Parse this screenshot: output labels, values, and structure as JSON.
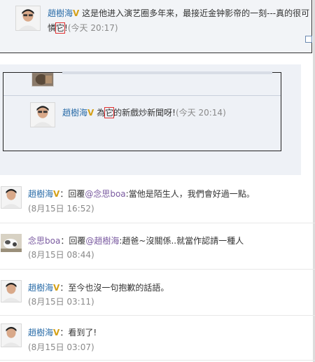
{
  "top_comment": {
    "author": "趙樹海",
    "verified_icon": "V",
    "text_part1": "这是他进入演艺圈多年来，最接近金钟影帝的一刻---真的很可",
    "text_part2": "憐",
    "highlight": "它",
    "text_part3": "!",
    "time": "(今天 20:17)"
  },
  "middle_comment": {
    "author": "趙樹海",
    "verified_icon": "V",
    "prefix": "為",
    "highlight": "它",
    "rest": "的新戲炒新聞呀!",
    "time": "(今天 20:14)"
  },
  "feed": [
    {
      "author": "趙樹海",
      "verified": true,
      "text_pre": "：回覆",
      "mention": "@念思boa",
      "text_post": ":當他是陌生人，我們會好過一點。",
      "time": "(8月15日 16:52)"
    },
    {
      "author": "念思boa",
      "verified": false,
      "text_pre": "：回覆",
      "mention": "@趙樹海",
      "text_post": ":趙爸~沒關係..就當作認請一種人",
      "time": "(8月15日 08:44)"
    },
    {
      "author": "趙樹海",
      "verified": true,
      "text_pre": "：至今也沒一句抱歉的話語。",
      "mention": "",
      "text_post": "",
      "time": "(8月15日 03:11)"
    },
    {
      "author": "趙樹海",
      "verified": true,
      "text_pre": "：看到了!",
      "mention": "",
      "text_post": "",
      "time": "(8月15日 03:07)"
    }
  ],
  "icons": {
    "verified": "verified-v-icon",
    "avatar_man": "avatar-man-photo",
    "avatar_dog": "avatar-dog-photo"
  },
  "colors": {
    "name_link": "#2a6ca8",
    "mention_link": "#7a5aa0",
    "verified": "#d4a017",
    "highlight_box": "#e03030",
    "time": "#8a8a8a"
  }
}
